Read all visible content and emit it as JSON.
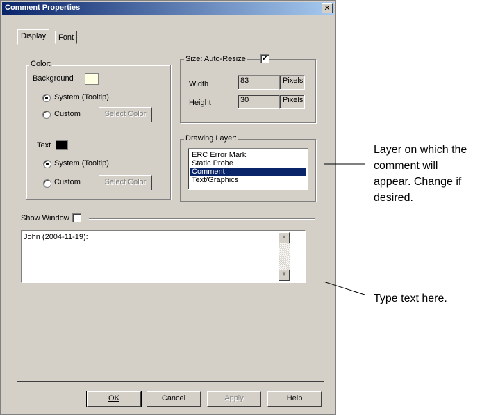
{
  "window": {
    "title": "Comment Properties",
    "close_glyph": "✕"
  },
  "tabs": [
    {
      "label": "Display",
      "active": true
    },
    {
      "label": "Font",
      "active": false
    }
  ],
  "color_group": {
    "legend": "Color:",
    "background": {
      "label": "Background",
      "swatch_color": "#ffffe1",
      "radio_system": "System (Tooltip)",
      "radio_custom": "Custom",
      "select_button": "Select Color",
      "selected": "system"
    },
    "text": {
      "label": "Text",
      "swatch_color": "#000000",
      "radio_system": "System (Tooltip)",
      "radio_custom": "Custom",
      "select_button": "Select Color",
      "selected": "system"
    }
  },
  "size_group": {
    "legend": "Size:",
    "auto_resize_label": "Auto-Resize",
    "auto_resize_checked": true,
    "width_label": "Width",
    "width_value": "83",
    "height_label": "Height",
    "height_value": "30",
    "unit": "Pixels"
  },
  "layer_group": {
    "legend": "Drawing Layer:",
    "items": [
      "ERC Error Mark",
      "Static Probe",
      "Comment",
      "Text/Graphics"
    ],
    "selected_index": 2
  },
  "show_window": {
    "label": "Show Window",
    "checked": false
  },
  "comment_text": "John (2004-11-19):",
  "buttons": {
    "ok": "OK",
    "cancel": "Cancel",
    "apply": "Apply",
    "help": "Help"
  },
  "annotations": {
    "layer_note": [
      "Layer on which the",
      "comment will",
      "appear. Change if",
      "desired."
    ],
    "text_note": "Type text here."
  }
}
